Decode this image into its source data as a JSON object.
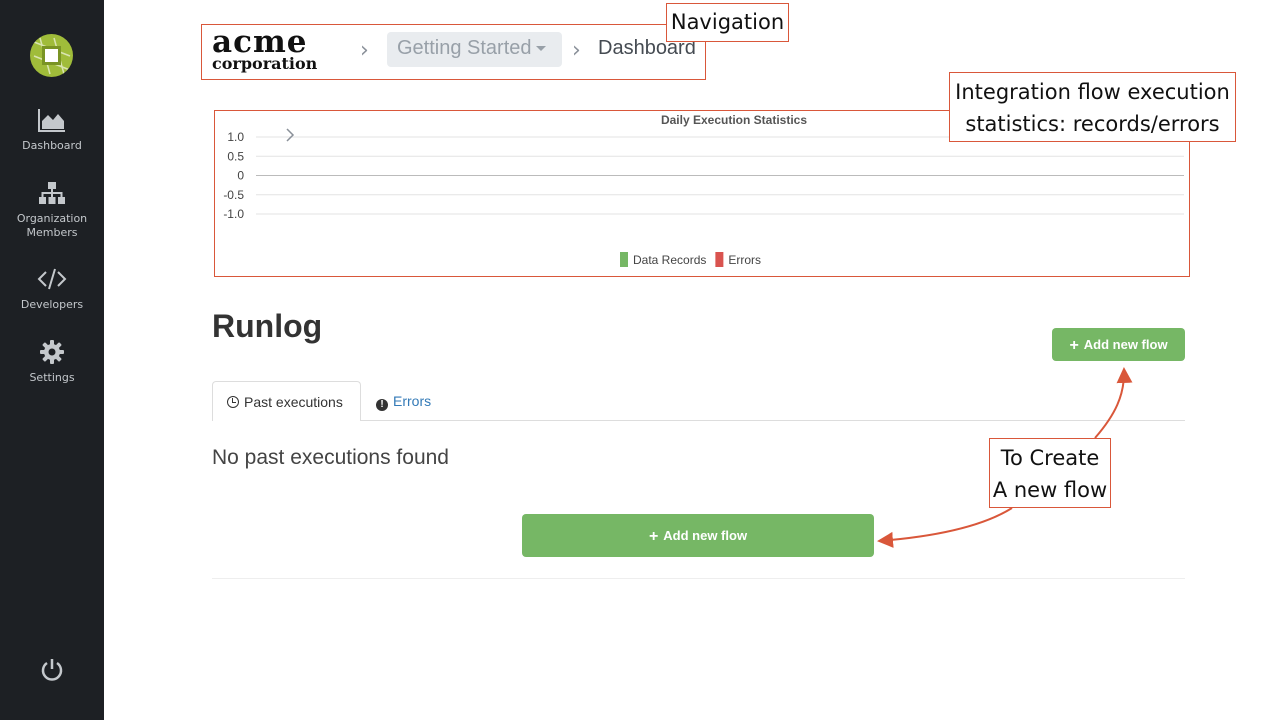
{
  "sidebar": {
    "items": [
      {
        "label": "Dashboard",
        "icon": "area-chart-icon"
      },
      {
        "label": "Organization Members",
        "label_line1": "Organization",
        "label_line2": "Members",
        "icon": "org-chart-icon"
      },
      {
        "label": "Developers",
        "icon": "code-icon"
      },
      {
        "label": "Settings",
        "icon": "gear-icon"
      }
    ],
    "footer_icon": "power-icon"
  },
  "breadcrumb": {
    "logo_line1": "acme",
    "logo_line2": "corporation",
    "workspace": "Getting Started",
    "current": "Dashboard"
  },
  "annotations": {
    "navigation": "Navigation",
    "chart_line1": "Integration flow execution",
    "chart_line2": "statistics: records/errors",
    "create_line1": "To Create",
    "create_line2": "A new flow"
  },
  "chart_data": {
    "type": "bar",
    "title": "Daily Execution Statistics",
    "categories": [],
    "series": [
      {
        "name": "Data Records",
        "values": [],
        "color": "#76b765"
      },
      {
        "name": "Errors",
        "values": [],
        "color": "#d9534f"
      }
    ],
    "yticks": [
      "1.0",
      "0.5",
      "0",
      "-0.5",
      "-1.0"
    ],
    "ylim": [
      -1.0,
      1.0
    ],
    "legend": "bottom",
    "grid": true
  },
  "runlog": {
    "title": "Runlog",
    "add_button": "Add new flow",
    "tabs": [
      {
        "label": "Past executions",
        "active": true
      },
      {
        "label": "Errors",
        "active": false
      }
    ],
    "empty_message": "No past executions found",
    "add_button_main": "Add new flow"
  },
  "colors": {
    "sidebar": "#1d2024",
    "accent_green": "#76b765",
    "annotation": "#d9573a",
    "link": "#337ab7"
  }
}
